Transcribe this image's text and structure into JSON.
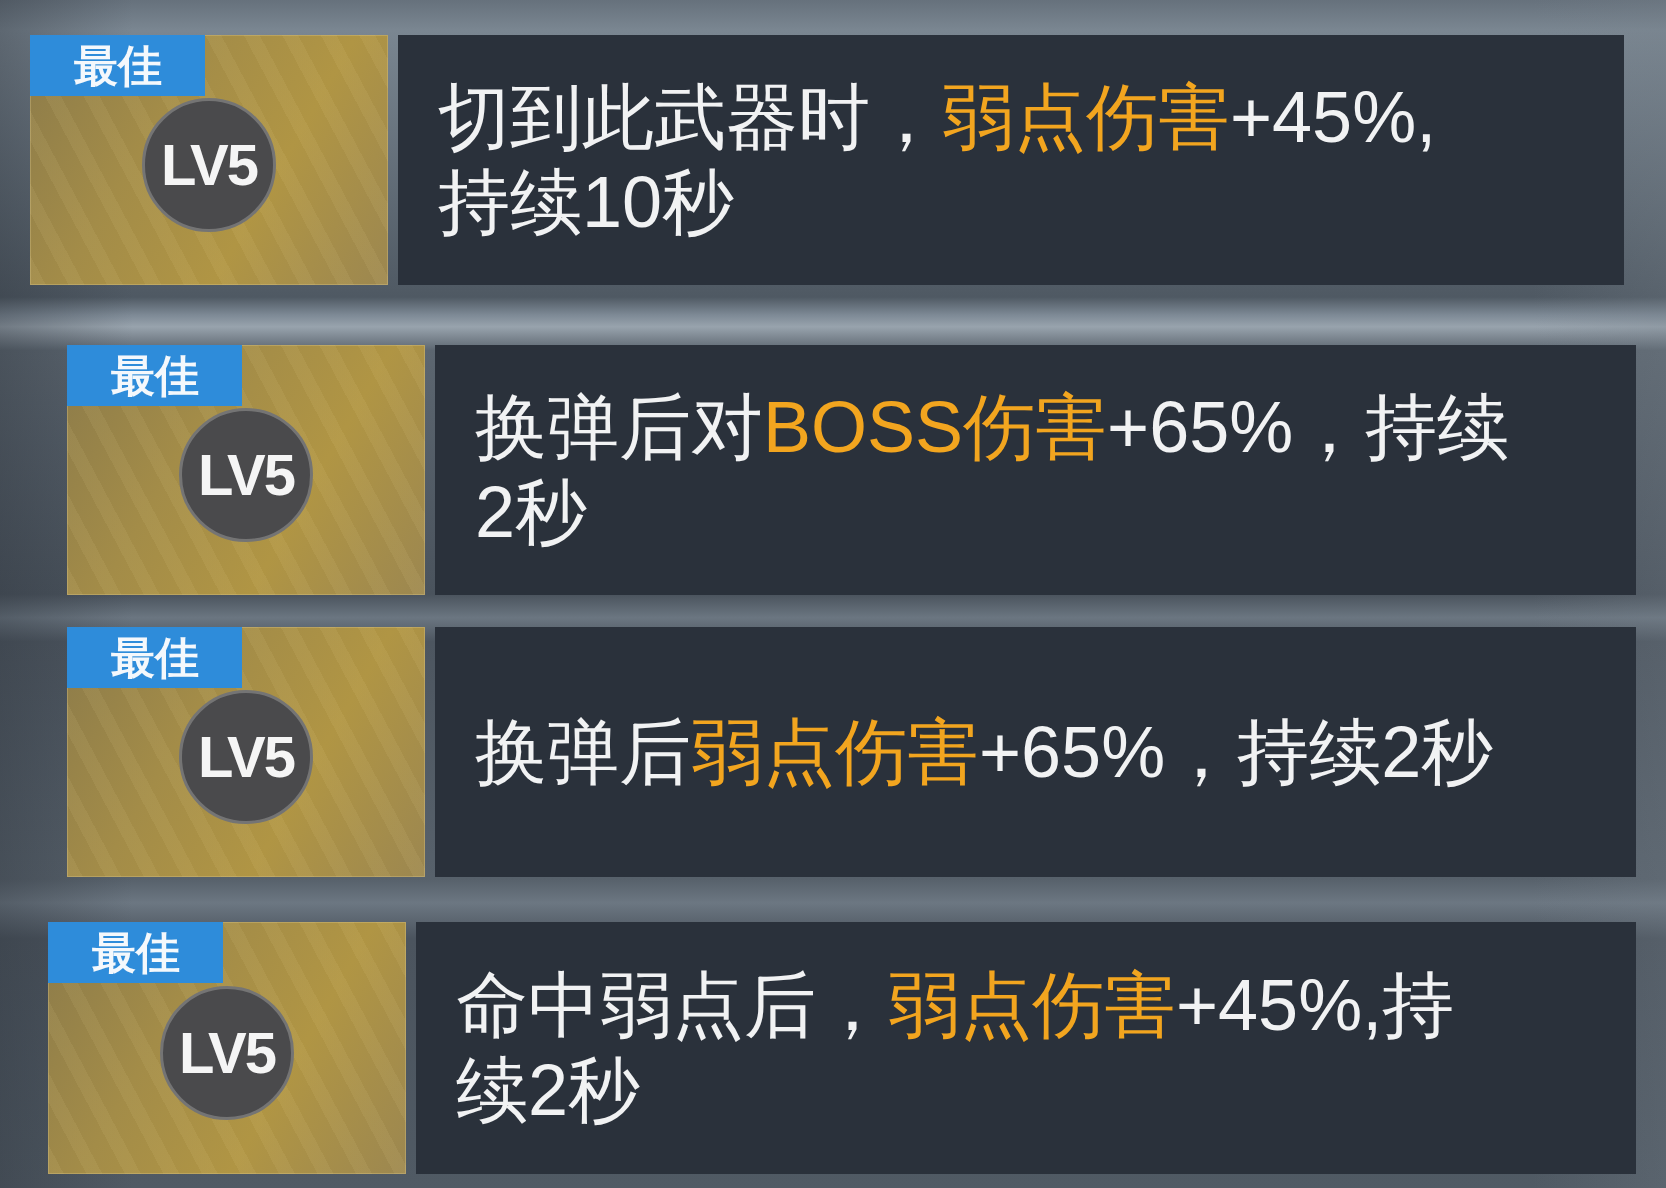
{
  "cards": [
    {
      "tag": "最佳",
      "grade": "LV5",
      "lines": [
        [
          {
            "text": "切到此武器时，",
            "highlight": false
          },
          {
            "text": "弱点伤害",
            "highlight": true
          },
          {
            "text": "+45%,",
            "highlight": false
          }
        ],
        [
          {
            "text": "持续10秒",
            "highlight": false
          }
        ]
      ]
    },
    {
      "tag": "最佳",
      "grade": "LV5",
      "lines": [
        [
          {
            "text": "换弹后对",
            "highlight": false
          },
          {
            "text": "BOSS伤害",
            "highlight": true
          },
          {
            "text": "+65%，持续",
            "highlight": false
          }
        ],
        [
          {
            "text": "2秒",
            "highlight": false
          }
        ]
      ]
    },
    {
      "tag": "最佳",
      "grade": "LV5",
      "lines": [
        [
          {
            "text": "换弹后",
            "highlight": false
          },
          {
            "text": "弱点伤害",
            "highlight": true
          },
          {
            "text": "+65%，持续2秒",
            "highlight": false
          }
        ]
      ]
    },
    {
      "tag": "最佳",
      "grade": "LV5",
      "lines": [
        [
          {
            "text": "命中弱点后，",
            "highlight": false
          },
          {
            "text": "弱点伤害",
            "highlight": true
          },
          {
            "text": "+45%,持",
            "highlight": false
          }
        ],
        [
          {
            "text": "续2秒",
            "highlight": false
          }
        ]
      ]
    }
  ]
}
